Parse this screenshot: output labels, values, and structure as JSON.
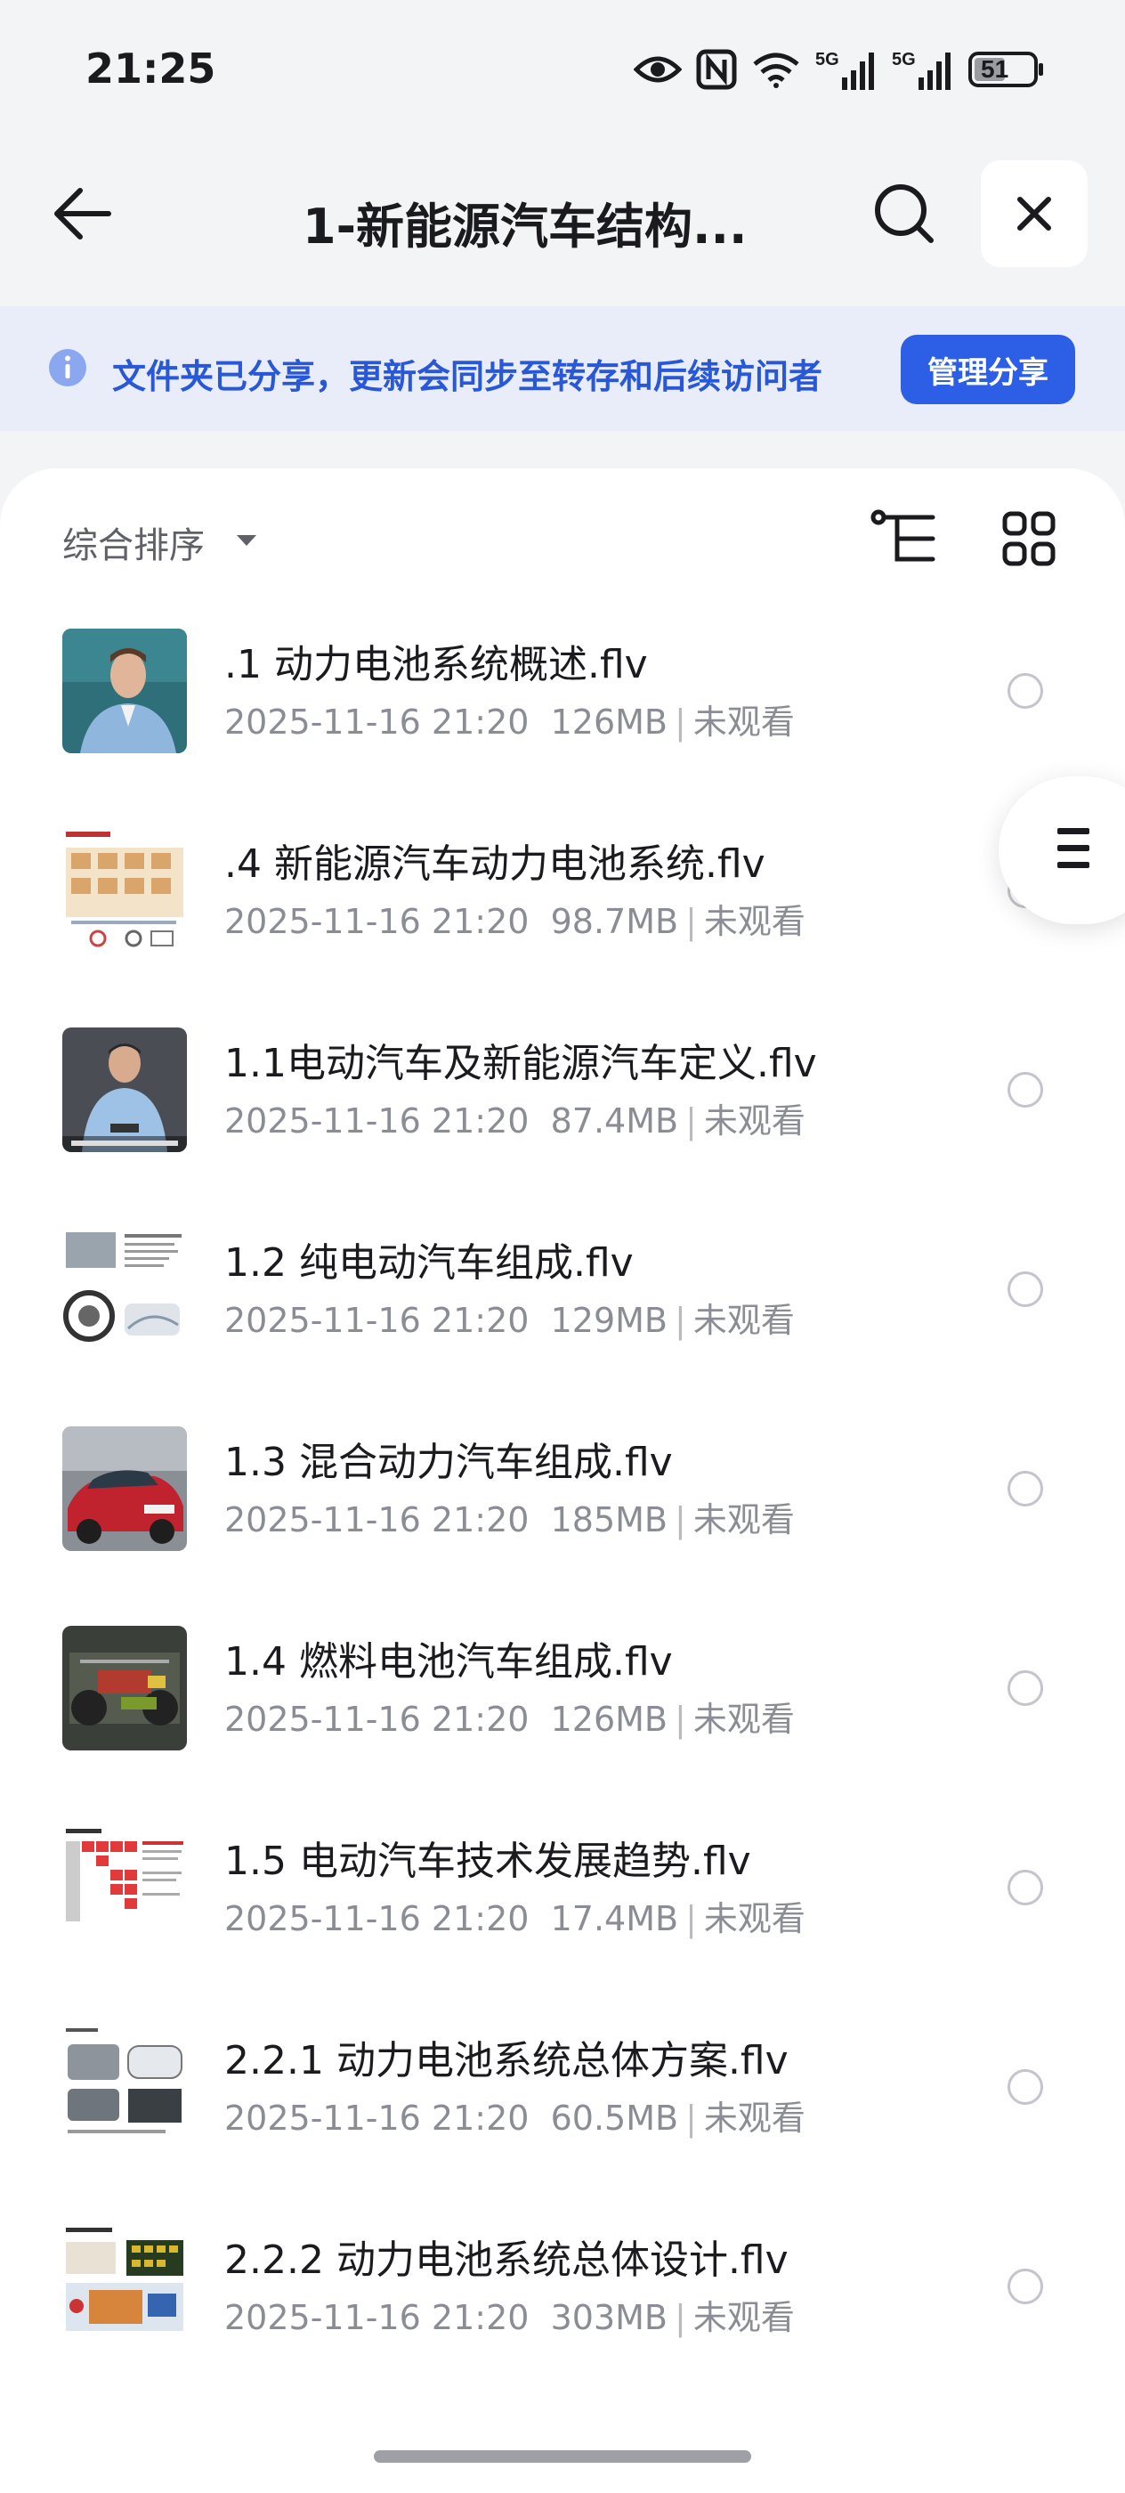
{
  "status_bar": {
    "time": "21:25",
    "battery": "51",
    "icons": [
      "eye-icon",
      "nfc-icon",
      "wifi-icon",
      "signal-5g-icon",
      "signal-5g-icon",
      "battery-icon"
    ]
  },
  "header": {
    "title": "1-新能源汽车结构..."
  },
  "share_banner": {
    "text": "文件夹已分享，更新会同步至转存和后续访问者",
    "button_label": "管理分享"
  },
  "toolbar": {
    "sort_label": "综合排序"
  },
  "files": [
    {
      "name": ".1 动力电池系统概述.flv",
      "date": "2025-11-16 21:20",
      "size": "126MB",
      "status": "未观看",
      "thumb": "person-blue"
    },
    {
      "name": ".4 新能源汽车动力电池系统.flv",
      "date": "2025-11-16 21:20",
      "size": "98.7MB",
      "status": "未观看",
      "thumb": "diagram-grid"
    },
    {
      "name": "1.1电动汽车及新能源汽车定义.flv",
      "date": "2025-11-16 21:20",
      "size": "87.4MB",
      "status": "未观看",
      "thumb": "person-dark"
    },
    {
      "name": "1.2 纯电动汽车组成.flv",
      "date": "2025-11-16 21:20",
      "size": "129MB",
      "status": "未观看",
      "thumb": "slide-parts"
    },
    {
      "name": "1.3 混合动力汽车组成.flv",
      "date": "2025-11-16 21:20",
      "size": "185MB",
      "status": "未观看",
      "thumb": "red-car"
    },
    {
      "name": "1.4 燃料电池汽车组成.flv",
      "date": "2025-11-16 21:20",
      "size": "126MB",
      "status": "未观看",
      "thumb": "chassis"
    },
    {
      "name": "1.5 电动汽车技术发展趋势.flv",
      "date": "2025-11-16 21:20",
      "size": "17.4MB",
      "status": "未观看",
      "thumb": "red-table"
    },
    {
      "name": "2.2.1 动力电池系统总体方案.flv",
      "date": "2025-11-16 21:20",
      "size": "60.5MB",
      "status": "未观看",
      "thumb": "cars-slide"
    },
    {
      "name": "2.2.2 动力电池系统总体设计.flv",
      "date": "2025-11-16 21:20",
      "size": "303MB",
      "status": "未观看",
      "thumb": "design-slide"
    }
  ],
  "colors": {
    "accent": "#2d5ee6",
    "banner_bg": "#e9edfa",
    "banner_text": "#2857d8",
    "meta_text": "#8b8d95"
  }
}
